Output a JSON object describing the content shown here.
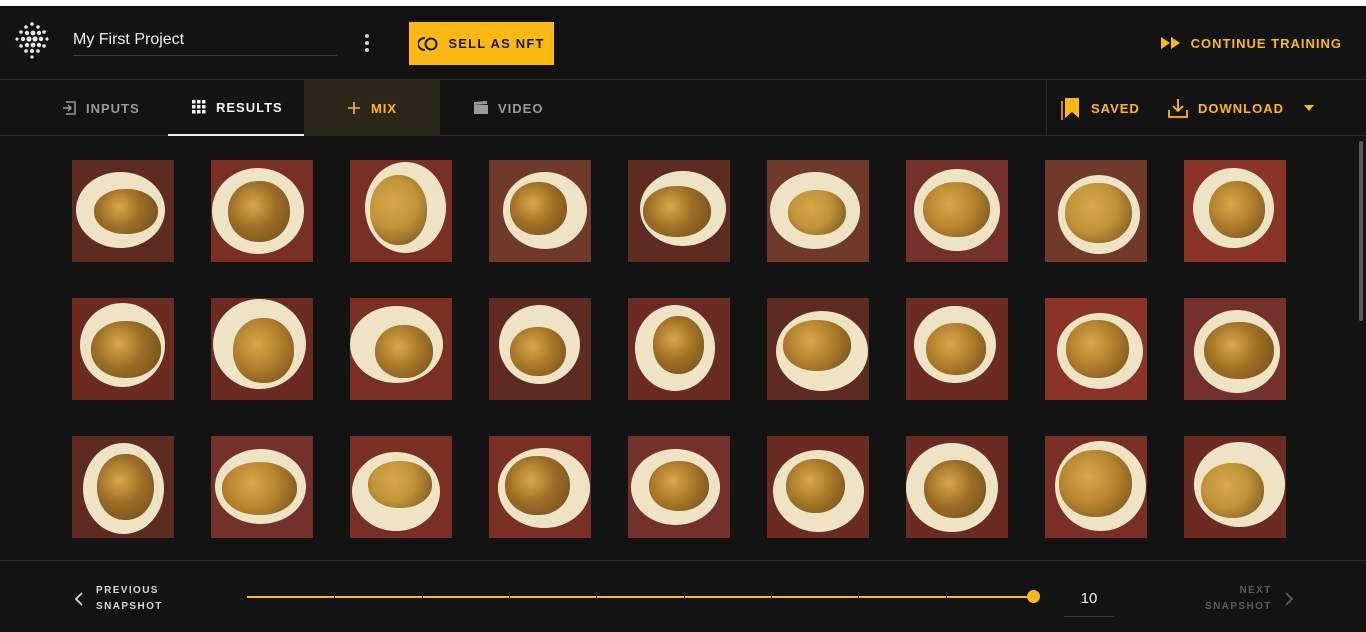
{
  "header": {
    "project_title": "My First Project",
    "sell_nft_label": "SELL AS NFT",
    "continue_label": "CONTINUE TRAINING"
  },
  "tabs": {
    "inputs": "INPUTS",
    "results": "RESULTS",
    "mix": "MIX",
    "video": "VIDEO",
    "active": "RESULTS"
  },
  "actions": {
    "saved_label": "SAVED",
    "download_label": "DOWNLOAD"
  },
  "results_grid": {
    "rows": 3,
    "columns": 9,
    "thumbnail_count_visible": 27
  },
  "footer": {
    "previous_label_line1": "PREVIOUS",
    "previous_label_line2": "SNAPSHOT",
    "next_label_line1": "NEXT",
    "next_label_line2": "SNAPSHOT",
    "snapshot_value": "10",
    "slider_fraction": 1.0
  },
  "colors": {
    "accent": "#fdb913",
    "background": "#131313",
    "mix_tab_bg": "#2b2617"
  },
  "icons": [
    "app-logo-icon",
    "kebab-menu-icon",
    "nft-icon",
    "fast-forward-icon",
    "inputs-icon",
    "grid-icon",
    "plus-icon",
    "video-icon",
    "bookmark-icon",
    "download-icon",
    "chevron-down-icon",
    "chevron-left-icon",
    "chevron-right-icon"
  ]
}
